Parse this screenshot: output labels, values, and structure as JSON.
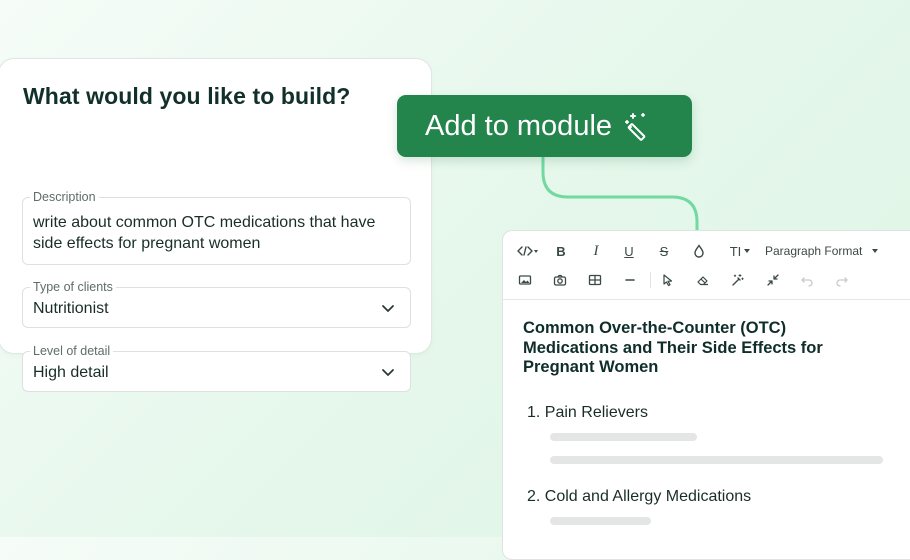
{
  "form": {
    "title": "What would you like to build?",
    "description": {
      "label": "Description",
      "value": "write about common OTC medications that have side effects for pregnant women"
    },
    "client_type": {
      "label": "Type of clients",
      "value": "Nutritionist"
    },
    "detail_level": {
      "label": "Level of detail",
      "value": "High detail"
    }
  },
  "action_button": {
    "label": "Add to module",
    "icon": "magic-wand-icon"
  },
  "editor": {
    "toolbar": {
      "row1": [
        "code-view-icon",
        "bold-icon",
        "italic-icon",
        "underline-icon",
        "strikethrough-icon",
        "color-drop-icon",
        "text-size-icon",
        "paragraph-format-dropdown"
      ],
      "row2": [
        "image-icon",
        "camera-icon",
        "table-icon",
        "horizontal-rule-icon",
        "cursor-icon",
        "eraser-icon",
        "magic-wand-icon",
        "collapse-icon",
        "undo-icon",
        "redo-icon"
      ],
      "bold_label": "B",
      "italic_label": "I",
      "underline_label": "U",
      "strike_label": "S",
      "text_size_label": "TI",
      "paragraph_format_label": "Paragraph Format"
    },
    "title": "Common Over-the-Counter (OTC) Medications and Their Side Effects for Pregnant Women",
    "items": [
      {
        "number": "1.",
        "text": "Pain Relievers"
      },
      {
        "number": "2.",
        "text": "Cold and Allergy Medications"
      }
    ]
  },
  "colors": {
    "accent": "#23844c",
    "connector": "#6fdca0",
    "background": "#e4f7ea",
    "heading_text": "#12302a"
  }
}
